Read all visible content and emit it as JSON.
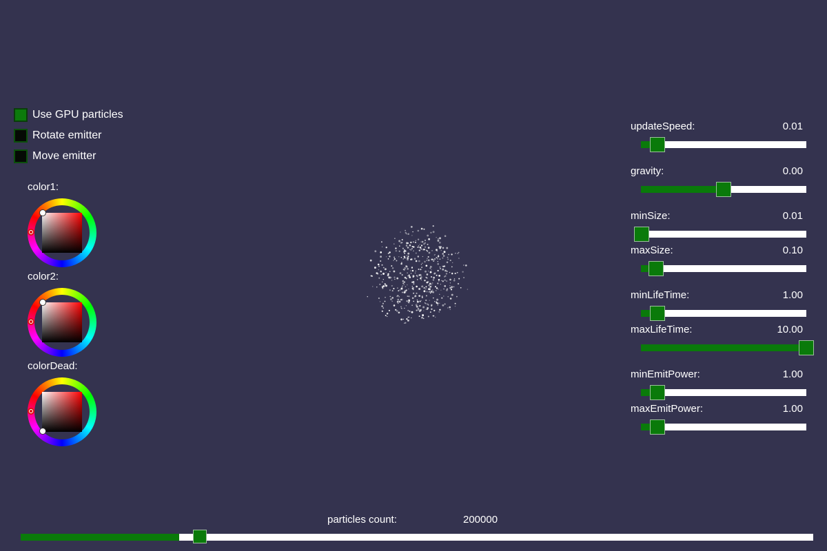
{
  "checkboxes": [
    {
      "label": "Use GPU particles",
      "checked": true
    },
    {
      "label": "Rotate emitter",
      "checked": false
    },
    {
      "label": "Move emitter",
      "checked": false
    }
  ],
  "color_pickers": [
    {
      "label": "color1:"
    },
    {
      "label": "color2:"
    },
    {
      "label": "colorDead:"
    }
  ],
  "sliders": [
    {
      "label": "updateSpeed:",
      "value": "0.01",
      "fraction": 0.1
    },
    {
      "label": "gravity:",
      "value": "0.00",
      "fraction": 0.5
    },
    {
      "label": "minSize:",
      "value": "0.01",
      "fraction": 0.0
    },
    {
      "label": "maxSize:",
      "value": "0.10",
      "fraction": 0.09
    },
    {
      "label": "minLifeTime:",
      "value": "1.00",
      "fraction": 0.1
    },
    {
      "label": "maxLifeTime:",
      "value": "10.00",
      "fraction": 1.0
    },
    {
      "label": "minEmitPower:",
      "value": "1.00",
      "fraction": 0.1
    },
    {
      "label": "maxEmitPower:",
      "value": "1.00",
      "fraction": 0.1
    }
  ],
  "particles_count": {
    "label": "particles count:",
    "value": "200000",
    "fraction": 0.2
  },
  "colors": {
    "accent": "#0a7a0a",
    "background": "#34334f",
    "track": "#ffffff"
  }
}
